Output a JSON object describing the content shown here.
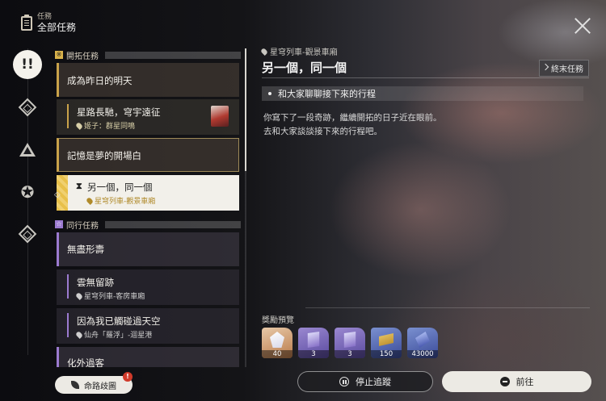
{
  "header": {
    "category": "任務",
    "title": "全部任務"
  },
  "sidebar": {
    "main_icon_text": "!!",
    "icons": [
      "trailblaze-icon",
      "companion-icon",
      "adventure-icon",
      "daily-icon"
    ]
  },
  "sections": {
    "trailblaze": {
      "box": "※",
      "label": "開拓任務"
    },
    "companion": {
      "box": "☆",
      "label": "同行任務"
    }
  },
  "quests": [
    {
      "label": "成為昨日的明天"
    },
    {
      "label": "星路長馳，穹宇遠征",
      "location": "姬子：群星同鳴"
    },
    {
      "label": "記憶是夢的開場白"
    },
    {
      "label": "另一個，同一個",
      "location": "星穹列車-觀景車廂"
    },
    {
      "label": "無盡形壽"
    },
    {
      "label": "雲無留跡",
      "location": "星穹列車-客房車廂"
    },
    {
      "label": "因為我已觸碰過天空",
      "location": "仙舟「羅浮」-迴星港"
    },
    {
      "label": "化外過客"
    }
  ],
  "detail": {
    "location": "星穹列車-觀景車廂",
    "title": "另一個，同一個",
    "tag": "終末任務",
    "objective": "和大家聊聊接下來的行程",
    "description_line1": "你寫下了一段奇跡，繼續開拓的日子近在眼前。",
    "description_line2": "去和大家談談接下來的行程吧。"
  },
  "rewards": {
    "label": "獎勵預覽",
    "items": [
      {
        "icon": "stellar-jade-icon",
        "count": "40"
      },
      {
        "icon": "purple-book-icon",
        "count": "3"
      },
      {
        "icon": "refine-material-icon",
        "count": "3"
      },
      {
        "icon": "credit-icon",
        "count": "150"
      },
      {
        "icon": "exp-icon",
        "count": "43000"
      }
    ]
  },
  "buttons": {
    "stop": "停止追蹤",
    "go": "前往",
    "route": "命路歧圖",
    "route_badge": "!"
  }
}
